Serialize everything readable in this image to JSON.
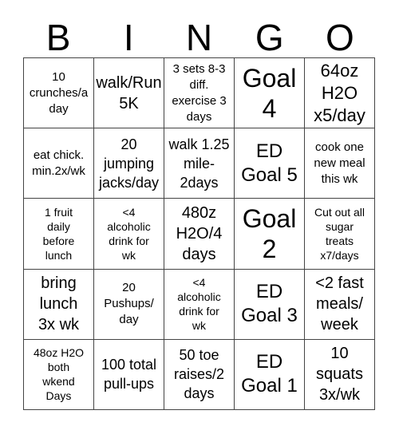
{
  "header": {
    "letters": [
      "B",
      "I",
      "N",
      "G",
      "O"
    ]
  },
  "cells": [
    [
      "10\ncrunches/a\nday",
      "walk/Run\n5K",
      "3 sets 8-3\ndiff.\nexercise 3\ndays",
      "Goal\n4",
      "64oz\nH2O\nx5/day"
    ],
    [
      "eat chick.\nmin.2x/wk",
      "20\njumping\njacks/day",
      "walk 1.25\nmile-\n2days",
      "ED\nGoal 5",
      "cook one\nnew meal\nthis wk"
    ],
    [
      "1 fruit\ndaily\nbefore\nlunch",
      "<4\nalcoholic\ndrink for\nwk",
      "480z\nH2O/4\ndays",
      "Goal\n2",
      "Cut out all\nsugar\ntreats\nx7/days"
    ],
    [
      "bring\nlunch\n3x wk",
      "20\nPushups/\nday",
      "<4\nalcoholic\ndrink for\nwk",
      "ED\nGoal 3",
      "<2 fast\nmeals/\nweek"
    ],
    [
      "48oz H2O\nboth\nwkend\nDays",
      "100 total\npull-ups",
      "50 toe\nraises/2\ndays",
      "ED\nGoal 1",
      "10\nsquats\n3x/wk"
    ]
  ]
}
